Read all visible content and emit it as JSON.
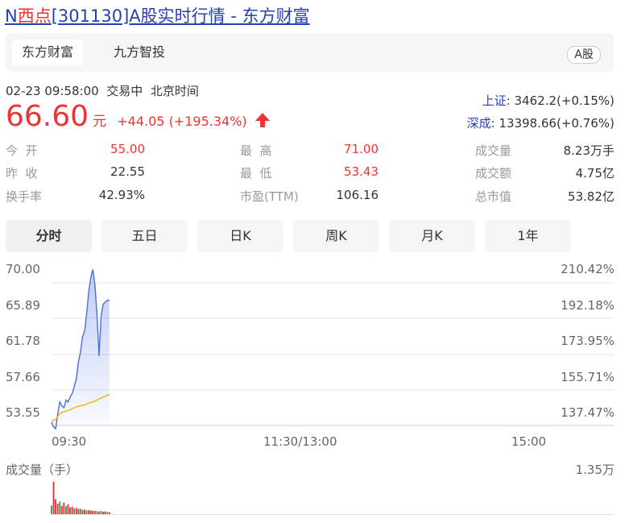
{
  "title": {
    "prefix": "N",
    "highlight": "西点",
    "rest": "[301130]A股实时行情 - 东方财富"
  },
  "source_tabs": [
    {
      "label": "东方财富"
    },
    {
      "label": "九方智投"
    }
  ],
  "market_badge": "A股",
  "status": {
    "datetime": "02-23 09:58:00",
    "state": "交易中",
    "timezone": "北京时间"
  },
  "quote": {
    "price": "66.60",
    "unit": "元",
    "change": "+44.05",
    "change_pct": "(+195.34%)",
    "arrow": "up-arrow-icon"
  },
  "indices": [
    {
      "name": "上证:",
      "value": "3462.2(+0.15%)"
    },
    {
      "name": "深成:",
      "value": "13398.66(+0.76%)"
    }
  ],
  "stats": {
    "open": {
      "label": "今  开",
      "value": "55.00"
    },
    "prev": {
      "label": "昨  收",
      "value": "22.55"
    },
    "turnover": {
      "label": "换手率",
      "value": "42.93%"
    },
    "high": {
      "label": "最  高",
      "value": "71.00"
    },
    "low": {
      "label": "最  低",
      "value": "53.43"
    },
    "pe": {
      "label": "市盈(TTM)",
      "value": "106.16"
    },
    "volume": {
      "label": "成交量",
      "value": "8.23万手"
    },
    "amount": {
      "label": "成交额",
      "value": "4.75亿"
    },
    "mktcap": {
      "label": "总市值",
      "value": "53.82亿"
    }
  },
  "period_tabs": [
    {
      "label": "分时"
    },
    {
      "label": "五日"
    },
    {
      "label": "日K"
    },
    {
      "label": "周K"
    },
    {
      "label": "月K"
    },
    {
      "label": "1年"
    }
  ],
  "chart_data": {
    "type": "line",
    "y_price_ticks": [
      "70.00",
      "65.89",
      "61.78",
      "57.66",
      "53.55"
    ],
    "y_pct_ticks": [
      "210.42%",
      "192.18%",
      "173.95%",
      "155.71%",
      "137.47%"
    ],
    "x_ticks": [
      "09:30",
      "11:30/13:00",
      "15:00"
    ],
    "ylim": [
      53.55,
      70.0
    ],
    "session_minutes": 240,
    "grid": true,
    "series": [
      {
        "color": "#4a6fe0",
        "x": [
          0,
          1,
          2,
          3,
          4,
          5,
          6,
          7,
          8,
          9,
          10,
          11,
          12,
          13,
          14,
          15,
          16,
          17,
          18,
          19,
          20,
          21,
          22,
          23,
          24,
          25,
          26,
          27,
          28
        ],
        "y": [
          53.9,
          53.4,
          53.2,
          54.8,
          56.0,
          55.6,
          55.4,
          56.2,
          56.0,
          56.5,
          56.9,
          57.6,
          58.4,
          60.2,
          61.2,
          62.8,
          63.4,
          65.2,
          67.5,
          69.0,
          69.8,
          68.2,
          65.0,
          60.8,
          65.0,
          66.2,
          66.4,
          66.6,
          66.6
        ],
        "area": true
      },
      {
        "color": "#f0b400",
        "x": [
          0,
          2,
          4,
          6,
          8,
          10,
          12,
          14,
          16,
          18,
          20,
          22,
          24,
          26,
          28
        ],
        "y": [
          54.0,
          54.2,
          54.8,
          55.0,
          55.1,
          55.3,
          55.5,
          55.6,
          55.7,
          55.9,
          56.0,
          56.2,
          56.4,
          56.6,
          56.8
        ]
      }
    ]
  },
  "volume_chart": {
    "label": "成交量（手）",
    "max_label": "1.35万",
    "type": "bar",
    "max": 13500,
    "values": [
      3600,
      13500,
      6200,
      4400,
      5300,
      3500,
      4900,
      3300,
      4100,
      2800,
      3200,
      2400,
      2700,
      2200,
      2300,
      1800,
      1900,
      1600,
      1700,
      1500,
      1400,
      1400,
      1200,
      1100,
      1300,
      1000,
      1100,
      900,
      800
    ],
    "directions": [
      "down",
      "up",
      "up",
      "up",
      "down",
      "up",
      "up",
      "down",
      "up",
      "up",
      "up",
      "down",
      "up",
      "up",
      "down",
      "up",
      "up",
      "down",
      "up",
      "up",
      "up",
      "up",
      "down",
      "up",
      "down",
      "up",
      "up",
      "down",
      "up"
    ]
  }
}
